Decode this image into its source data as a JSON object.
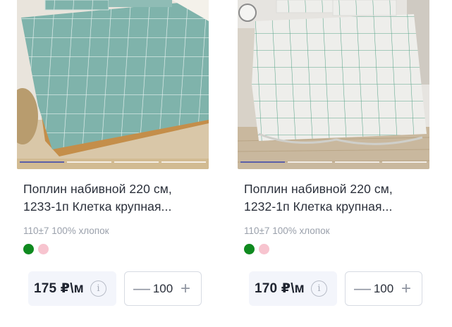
{
  "products": [
    {
      "title_line1": "Поплин набивной 220 см,",
      "title_line2": "1233-1п Клетка крупная...",
      "specs": "110±7 100% хлопок",
      "colors": [
        "#0f8a1f",
        "#f7c4cf"
      ],
      "price": "175 ₽\\м",
      "quantity": "100",
      "image_label": "teal-check-bedding-photo",
      "bedding_color": "#7fb3ab"
    },
    {
      "title_line1": "Поплин набивной 220 см,",
      "title_line2": "1232-1п Клетка крупная...",
      "specs": "110±7 100% хлопок",
      "colors": [
        "#0f8a1f",
        "#f7c4cf"
      ],
      "price": "170 ₽\\м",
      "quantity": "100",
      "image_label": "white-check-bedding-photo",
      "bedding_color": "#ecece9"
    }
  ],
  "controls": {
    "minus": "—",
    "plus": "+",
    "info": "i"
  }
}
